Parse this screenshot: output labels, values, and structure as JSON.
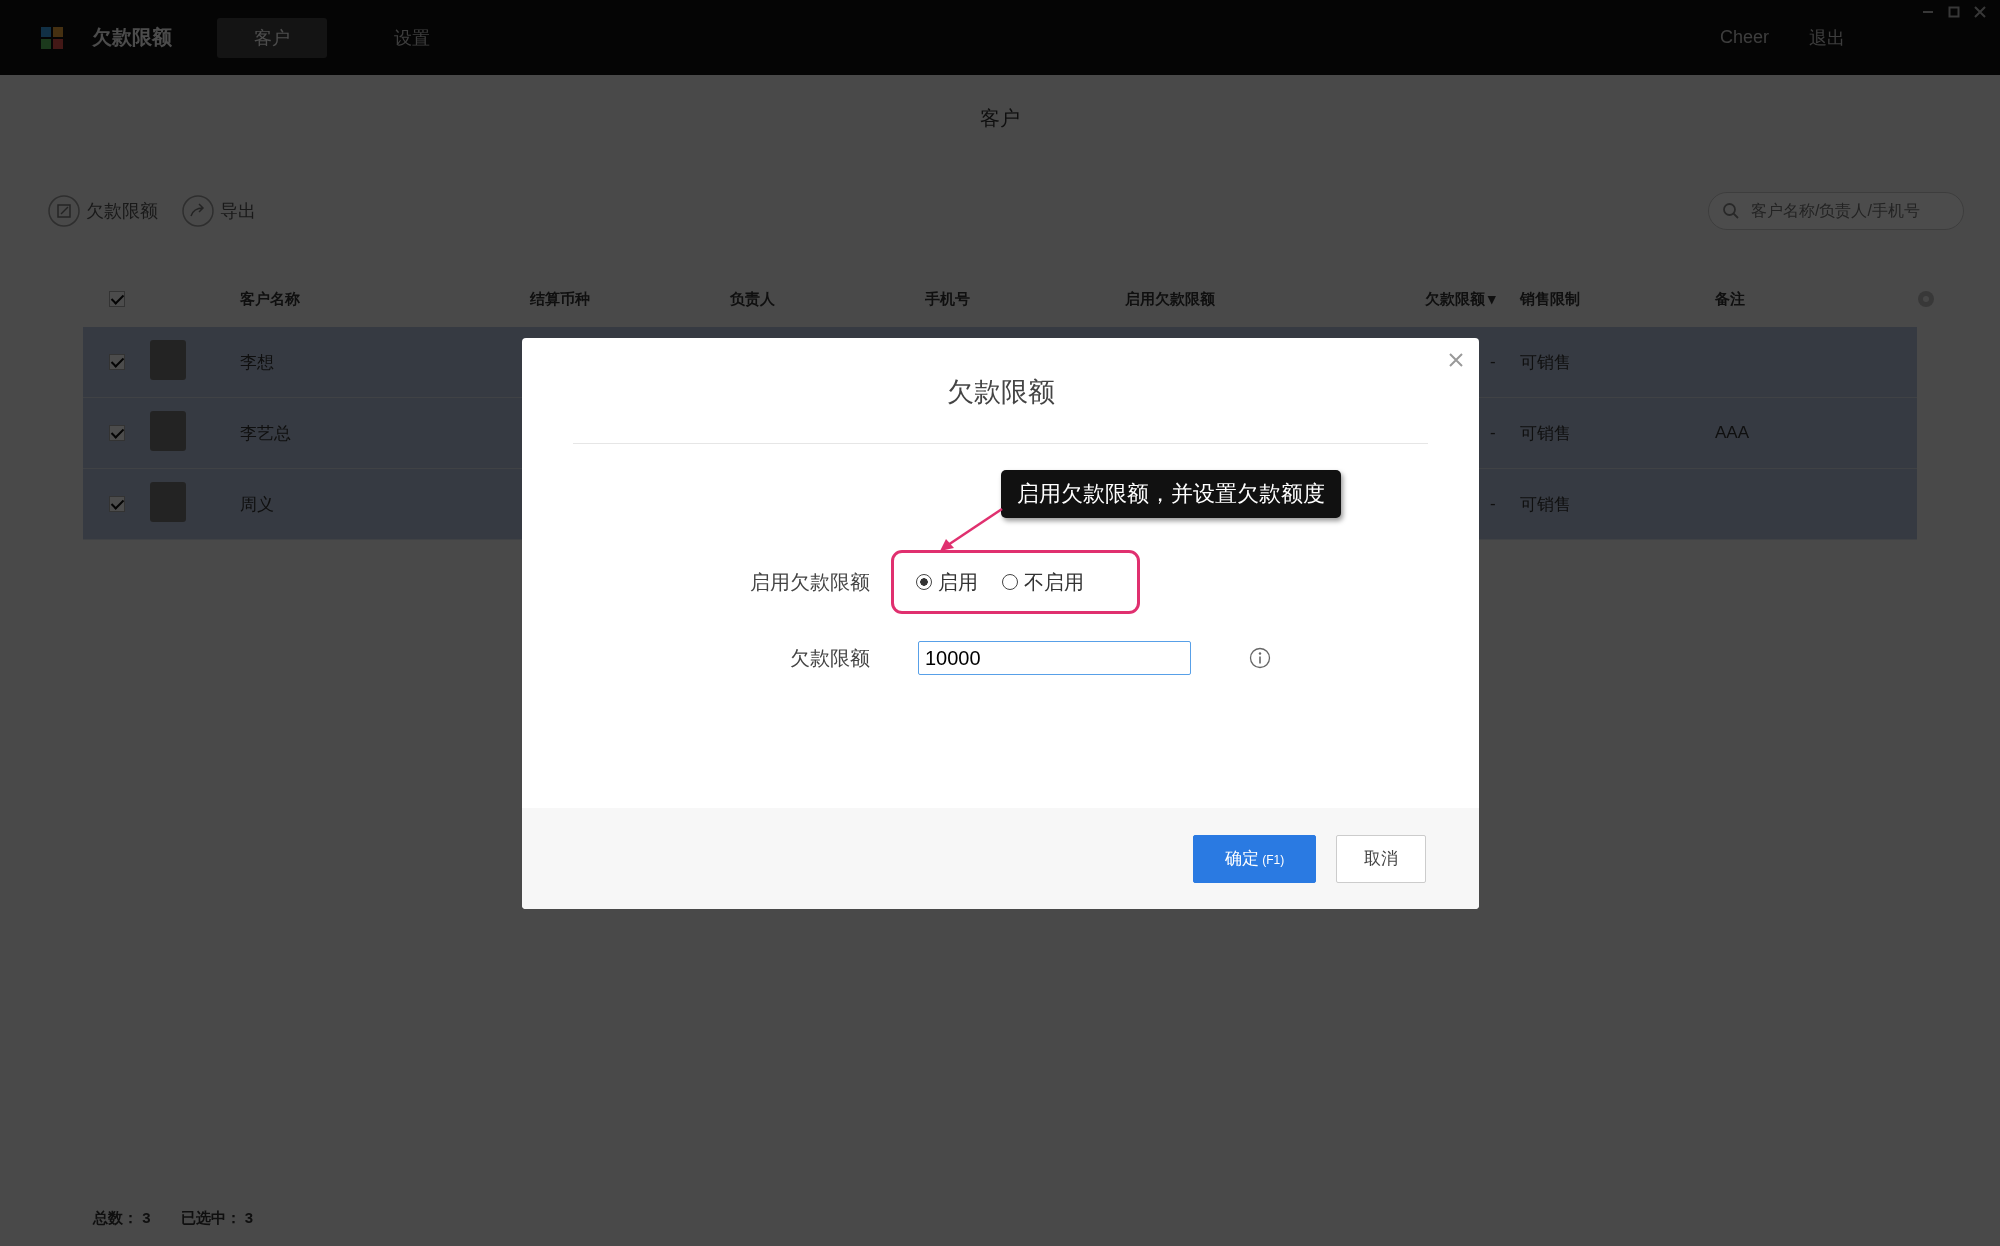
{
  "app": {
    "title": "欠款限额",
    "nav": [
      {
        "label": "客户",
        "selected": true
      },
      {
        "label": "设置",
        "selected": false
      }
    ],
    "user": "Cheer",
    "logout": "退出"
  },
  "page": {
    "title": "客户"
  },
  "toolbar": {
    "actions": [
      {
        "label": "欠款限额",
        "kind": "limit"
      },
      {
        "label": "导出",
        "kind": "export"
      }
    ],
    "search": {
      "placeholder": "客户名称/负责人/手机号"
    }
  },
  "table": {
    "all_checked": true,
    "columns": [
      {
        "label": "客户名称"
      },
      {
        "label": "结算币种"
      },
      {
        "label": "负责人"
      },
      {
        "label": "手机号"
      },
      {
        "label": "启用欠款限额"
      },
      {
        "label": "欠款限额",
        "sort_icon": "▾"
      },
      {
        "label": "销售限制"
      },
      {
        "label": "备注"
      }
    ],
    "rows": [
      {
        "selected": true,
        "checked": true,
        "name": "李想",
        "credit_limit": "-",
        "sales": "可销售"
      },
      {
        "selected": true,
        "checked": true,
        "name": "李艺总",
        "credit_limit": "-",
        "sales": "可销售",
        "note": "AAA"
      },
      {
        "selected": true,
        "checked": true,
        "name": "周义",
        "credit_limit": "-",
        "sales": "可销售"
      }
    ]
  },
  "footer": {
    "total": "总数：  3",
    "picked": "已选中：  3"
  },
  "dialog": {
    "title": "欠款限额",
    "annotation": "启用欠款限额，并设置欠款额度",
    "fields": [
      {
        "kind": "radio",
        "label": "启用欠款限额",
        "options": [
          {
            "label": "启用",
            "selected": true
          },
          {
            "label": "不启用",
            "selected": false
          }
        ]
      },
      {
        "kind": "text",
        "label": "欠款限额",
        "value": "10000"
      }
    ],
    "buttons": [
      {
        "kind": "primary",
        "label": "确定",
        "shortcut": "(F1)"
      },
      {
        "kind": "default",
        "label": "取消"
      }
    ]
  }
}
